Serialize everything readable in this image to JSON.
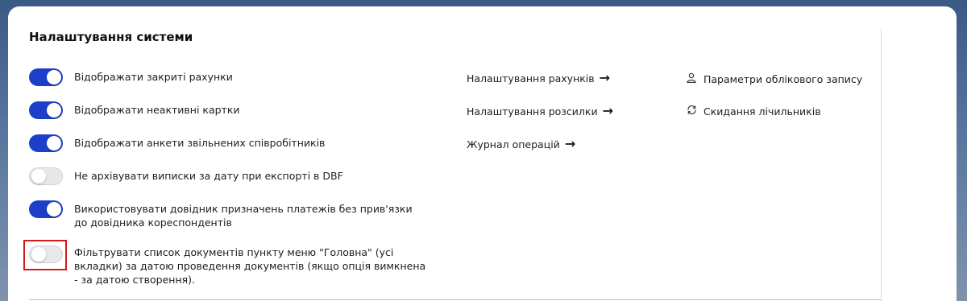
{
  "section": {
    "title": "Налаштування системи"
  },
  "options": [
    {
      "label": "Відображати закриті рахунки",
      "enabled": true
    },
    {
      "label": "Відображати неактивні картки",
      "enabled": true
    },
    {
      "label": "Відображати анкети звільнених співробітників",
      "enabled": true
    },
    {
      "label": "Не архівувати виписки за дату при експорті в DBF",
      "enabled": false
    },
    {
      "label": "Використовувати довідник призначень платежів без прив'язки до довідника кореспондентів",
      "enabled": true
    },
    {
      "label": "Фільтрувати список документів пункту меню \"Головна\" (усі вкладки) за датою проведення документів (якщо опція вимкнена - за датою створення).",
      "enabled": false
    }
  ],
  "links": [
    {
      "label": "Налаштування рахунків",
      "icon": "arrow-right-icon"
    },
    {
      "label": "Налаштування розсилки",
      "icon": "arrow-right-icon"
    },
    {
      "label": "Журнал операцій",
      "icon": "arrow-right-icon"
    }
  ],
  "actions": [
    {
      "label": "Параметри облікового запису",
      "icon": "user-icon"
    },
    {
      "label": "Скидання лічильників",
      "icon": "refresh-icon"
    }
  ],
  "colors": {
    "toggle_on": "#1b3fc8",
    "toggle_off": "#e7e8ea",
    "highlight": "#d11a1a"
  }
}
